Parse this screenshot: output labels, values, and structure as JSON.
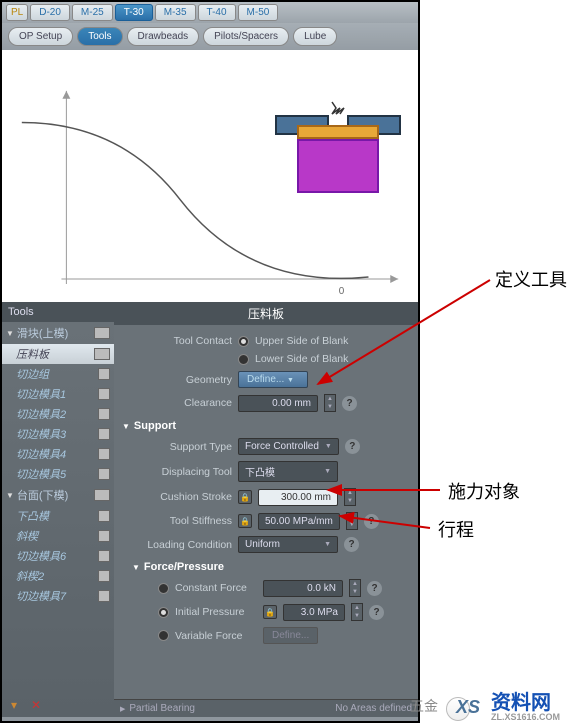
{
  "top_tabs": {
    "pl": "PL",
    "d20": "D-20",
    "m25": "M-25",
    "t30": "T-30",
    "m35": "M-35",
    "t40": "T-40",
    "m50": "M-50"
  },
  "toolbar": {
    "opsetup": "OP Setup",
    "tools": "Tools",
    "drawbeads": "Drawbeads",
    "pilots": "Pilots/Spacers",
    "lube": "Lube"
  },
  "sidebar": {
    "header": "Tools",
    "group1": "滑块(上模)",
    "items1": [
      "压料板",
      "切边组",
      "切边模具1",
      "切边模具2",
      "切边模具3",
      "切边模具4",
      "切边模具5"
    ],
    "group2": "台面(下模)",
    "items2": [
      "下凸模",
      "斜楔",
      "切边模具6",
      "斜楔2",
      "切边模具7"
    ],
    "foot_down": "▾",
    "foot_x": "✕"
  },
  "panel": {
    "header": "压料板",
    "tool_contact": "Tool Contact",
    "upper": "Upper Side of Blank",
    "lower": "Lower Side of Blank",
    "geometry": "Geometry",
    "define": "Define...",
    "clearance": "Clearance",
    "clearance_val": "0.00 mm",
    "support": "Support",
    "support_type": "Support Type",
    "support_type_val": "Force Controlled",
    "displacing_tool": "Displacing Tool",
    "displacing_tool_val": "下凸模",
    "cushion_stroke": "Cushion Stroke",
    "cushion_stroke_val": "300.00 mm",
    "tool_stiffness": "Tool Stiffness",
    "tool_stiffness_val": "50.00 MPa/mm",
    "loading": "Loading Condition",
    "loading_val": "Uniform",
    "force_pressure": "Force/Pressure",
    "constant_force": "Constant Force",
    "constant_force_val": "0.0 kN",
    "initial_pressure": "Initial Pressure",
    "initial_pressure_val": "3.0 MPa",
    "variable_force": "Variable Force",
    "footer_left": "Partial Bearing",
    "footer_right": "No Areas defined"
  },
  "annotations": {
    "a1": "定义工具",
    "a2": "施力对象",
    "a3": "行程"
  },
  "watermark": {
    "main": "资料网",
    "sub": "ZL.XS1616.COM",
    "left": "五金",
    "x": "XS"
  }
}
